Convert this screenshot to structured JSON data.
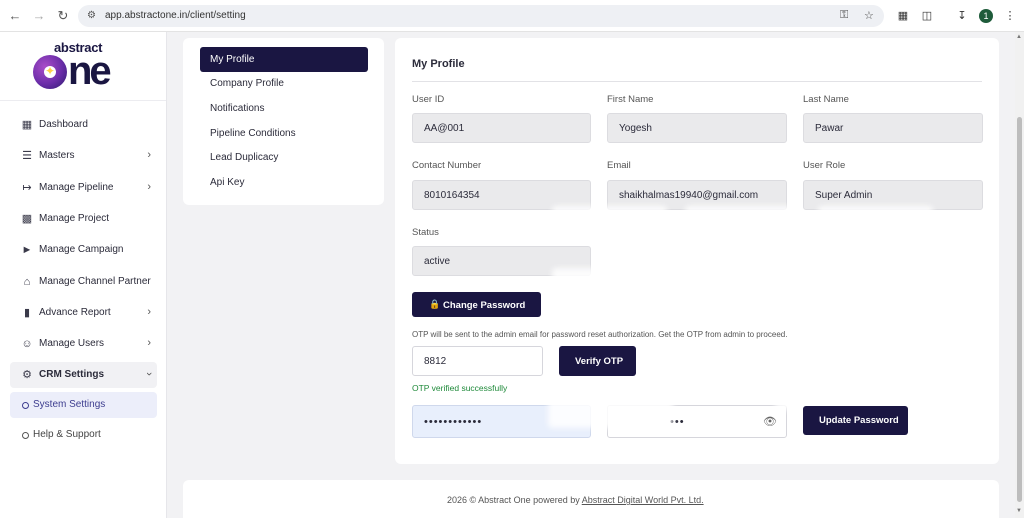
{
  "browser": {
    "url": "app.abstractone.in/client/setting",
    "avatar_letter": "1",
    "icons": [
      "back-icon",
      "forward-icon",
      "reload-icon",
      "site-info-icon",
      "key-icon",
      "star-icon",
      "extension-icon",
      "puzzle-icon",
      "download-icon",
      "menu-icon"
    ]
  },
  "logo": {
    "top": "abstract",
    "main": "one"
  },
  "sidebar": {
    "items": [
      {
        "label": "Dashboard",
        "icon": "dashboard-icon",
        "chevron": false
      },
      {
        "label": "Masters",
        "icon": "list-icon",
        "chevron": true
      },
      {
        "label": "Manage Pipeline",
        "icon": "pipeline-icon",
        "chevron": true
      },
      {
        "label": "Manage Project",
        "icon": "building-icon",
        "chevron": false
      },
      {
        "label": "Manage Campaign",
        "icon": "megaphone-icon",
        "chevron": false
      },
      {
        "label": "Manage Channel Partner",
        "icon": "partner-icon",
        "chevron": false
      },
      {
        "label": "Advance Report",
        "icon": "chart-icon",
        "chevron": true
      },
      {
        "label": "Manage Users",
        "icon": "users-icon",
        "chevron": true
      },
      {
        "label": "CRM Settings",
        "icon": "gear-icon",
        "chevron": true
      }
    ],
    "sub_active": "System Settings",
    "help": "Help & Support"
  },
  "settings_nav": {
    "items": [
      "My Profile",
      "Company Profile",
      "Notifications",
      "Pipeline Conditions",
      "Lead Duplicacy",
      "Api Key"
    ],
    "active_index": 0
  },
  "profile": {
    "title": "My Profile",
    "fields": {
      "user_id": {
        "label": "User ID",
        "value": "AA@001"
      },
      "first_name": {
        "label": "First Name",
        "value": "Yogesh"
      },
      "last_name": {
        "label": "Last Name",
        "value": "Pawar"
      },
      "contact": {
        "label": "Contact Number",
        "value": "8010164354"
      },
      "email": {
        "label": "Email",
        "value": "shaikhalmas19940@gmail.com"
      },
      "role": {
        "label": "User Role",
        "value": "Super Admin"
      },
      "status": {
        "label": "Status",
        "value": "active"
      }
    },
    "change_password_label": "Change Password",
    "otp_note": "OTP will be sent to the admin email for password reset authorization. Get the OTP from admin to proceed.",
    "otp_value": "8812",
    "verify_label": "Verify OTP",
    "otp_success": "OTP verified successfully",
    "new_password_mask": "••••••••••••",
    "confirm_password_mask": "•••",
    "update_label": "Update Password"
  },
  "footer": {
    "text": "2026 © Abstract One powered by ",
    "link": "Abstract Digital World Pvt. Ltd."
  }
}
